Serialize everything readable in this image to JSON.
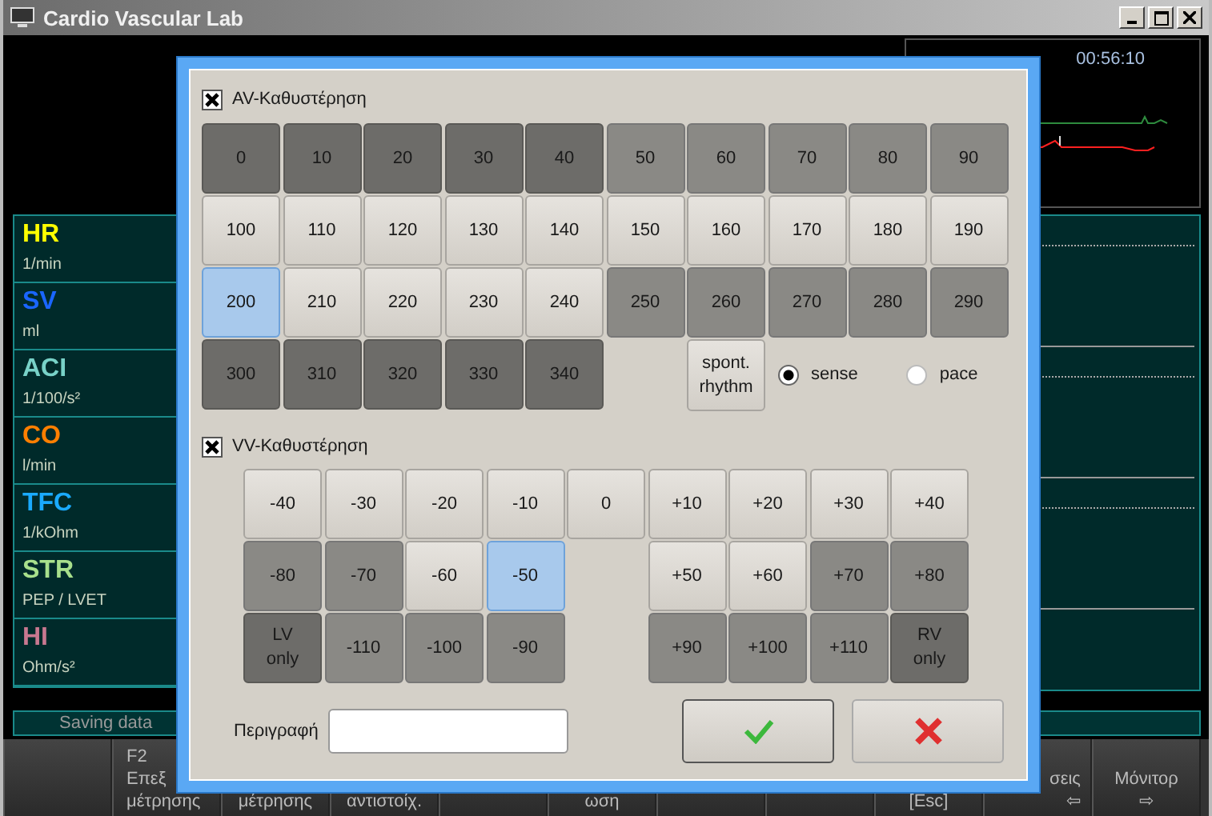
{
  "window": {
    "title": "Cardio Vascular Lab"
  },
  "timer": "00:56:10",
  "parameters": [
    {
      "name": "HR",
      "unit": "1/min",
      "color": "#ffff00"
    },
    {
      "name": "SV",
      "unit": "ml",
      "color": "#1a66ff"
    },
    {
      "name": "ACI",
      "unit": "1/100/s²",
      "color": "#78d2c8"
    },
    {
      "name": "CO",
      "unit": "l/min",
      "color": "#ff7f00"
    },
    {
      "name": "TFC",
      "unit": "1/kOhm",
      "color": "#1aaaff"
    },
    {
      "name": "STR",
      "unit": "PEP / LVET",
      "color": "#a8e08c"
    },
    {
      "name": "HI",
      "unit": "Ohm/s²",
      "color": "#c87890"
    }
  ],
  "status_bar": "Saving data",
  "function_keys": [
    {
      "kind": "blank"
    },
    {
      "kind": "cut_right",
      "lines": [
        "F2",
        "Επεξ",
        "μέτρησης"
      ]
    },
    {
      "kind": "label",
      "lines": [
        "μέτρησης"
      ]
    },
    {
      "kind": "label",
      "lines": [
        "αντιστοίχ."
      ]
    },
    {
      "kind": "blank"
    },
    {
      "kind": "label",
      "lines": [
        "ωση"
      ]
    },
    {
      "kind": "blank"
    },
    {
      "kind": "blank"
    },
    {
      "kind": "label",
      "lines": [
        "[Esc]"
      ]
    },
    {
      "kind": "cut_left",
      "lines": [
        "σεις",
        "⇦"
      ]
    },
    {
      "kind": "label",
      "lines": [
        "Μόνιτορ",
        "⇨"
      ]
    }
  ],
  "dialog": {
    "av_delay": {
      "label": "AV-Καθυστέρηση",
      "checked": true,
      "rows": [
        [
          {
            "label": "0",
            "kind": "dark",
            "selected": false
          },
          {
            "label": "10",
            "kind": "dark",
            "selected": false
          },
          {
            "label": "20",
            "kind": "dark",
            "selected": false
          },
          {
            "label": "30",
            "kind": "dark",
            "selected": false
          },
          {
            "label": "40",
            "kind": "dark",
            "selected": false
          },
          {
            "label": "50",
            "kind": "mid",
            "selected": false
          },
          {
            "label": "60",
            "kind": "mid",
            "selected": false
          },
          {
            "label": "70",
            "kind": "mid",
            "selected": false
          },
          {
            "label": "80",
            "kind": "mid",
            "selected": false
          },
          {
            "label": "90",
            "kind": "mid",
            "selected": false
          }
        ],
        [
          {
            "label": "100",
            "kind": "light",
            "selected": false
          },
          {
            "label": "110",
            "kind": "light",
            "selected": false
          },
          {
            "label": "120",
            "kind": "light",
            "selected": false
          },
          {
            "label": "130",
            "kind": "light",
            "selected": false
          },
          {
            "label": "140",
            "kind": "light",
            "selected": false
          },
          {
            "label": "150",
            "kind": "light",
            "selected": false
          },
          {
            "label": "160",
            "kind": "light",
            "selected": false
          },
          {
            "label": "170",
            "kind": "light",
            "selected": false
          },
          {
            "label": "180",
            "kind": "light",
            "selected": false
          },
          {
            "label": "190",
            "kind": "light",
            "selected": false
          }
        ],
        [
          {
            "label": "200",
            "kind": "light",
            "selected": true
          },
          {
            "label": "210",
            "kind": "light",
            "selected": false
          },
          {
            "label": "220",
            "kind": "light",
            "selected": false
          },
          {
            "label": "230",
            "kind": "light",
            "selected": false
          },
          {
            "label": "240",
            "kind": "light",
            "selected": false
          },
          {
            "label": "250",
            "kind": "mid",
            "selected": false
          },
          {
            "label": "260",
            "kind": "mid",
            "selected": false
          },
          {
            "label": "270",
            "kind": "mid",
            "selected": false
          },
          {
            "label": "280",
            "kind": "mid",
            "selected": false
          },
          {
            "label": "290",
            "kind": "mid",
            "selected": false
          }
        ],
        [
          {
            "label": "300",
            "kind": "dark",
            "selected": false
          },
          {
            "label": "310",
            "kind": "dark",
            "selected": false
          },
          {
            "label": "320",
            "kind": "dark",
            "selected": false
          },
          {
            "label": "330",
            "kind": "dark",
            "selected": false
          },
          {
            "label": "340",
            "kind": "dark",
            "selected": false
          }
        ]
      ],
      "spont_button": "spont.\nrhythm",
      "modes": [
        {
          "label": "sense",
          "selected": true
        },
        {
          "label": "pace",
          "selected": false
        }
      ]
    },
    "vv_delay": {
      "label": "VV-Καθυστέρηση",
      "checked": true,
      "rows": [
        {
          "left": [
            {
              "label": "-40",
              "kind": "light",
              "selected": false
            },
            {
              "label": "-30",
              "kind": "light",
              "selected": false
            },
            {
              "label": "-20",
              "kind": "light",
              "selected": false
            },
            {
              "label": "-10",
              "kind": "light",
              "selected": false
            }
          ],
          "middle": {
            "label": "0",
            "kind": "light",
            "selected": false
          },
          "right": [
            {
              "label": "+10",
              "kind": "light",
              "selected": false
            },
            {
              "label": "+20",
              "kind": "light",
              "selected": false
            },
            {
              "label": "+30",
              "kind": "light",
              "selected": false
            },
            {
              "label": "+40",
              "kind": "light",
              "selected": false
            }
          ]
        },
        {
          "left": [
            {
              "label": "-80",
              "kind": "mid",
              "selected": false
            },
            {
              "label": "-70",
              "kind": "mid",
              "selected": false
            },
            {
              "label": "-60",
              "kind": "light",
              "selected": false
            },
            {
              "label": "-50",
              "kind": "light",
              "selected": true
            }
          ],
          "right": [
            {
              "label": "+50",
              "kind": "light",
              "selected": false
            },
            {
              "label": "+60",
              "kind": "light",
              "selected": false
            },
            {
              "label": "+70",
              "kind": "mid",
              "selected": false
            },
            {
              "label": "+80",
              "kind": "mid",
              "selected": false
            }
          ]
        },
        {
          "left": [
            {
              "label": "LV\nonly",
              "kind": "dark",
              "selected": false
            },
            {
              "label": "-110",
              "kind": "mid",
              "selected": false
            },
            {
              "label": "-100",
              "kind": "mid",
              "selected": false
            },
            {
              "label": "-90",
              "kind": "mid",
              "selected": false
            }
          ],
          "right": [
            {
              "label": "+90",
              "kind": "mid",
              "selected": false
            },
            {
              "label": "+100",
              "kind": "mid",
              "selected": false
            },
            {
              "label": "+110",
              "kind": "mid",
              "selected": false
            },
            {
              "label": "RV\nonly",
              "kind": "dark",
              "selected": false
            }
          ]
        }
      ]
    },
    "description": {
      "label": "Περιγραφή"
    }
  }
}
